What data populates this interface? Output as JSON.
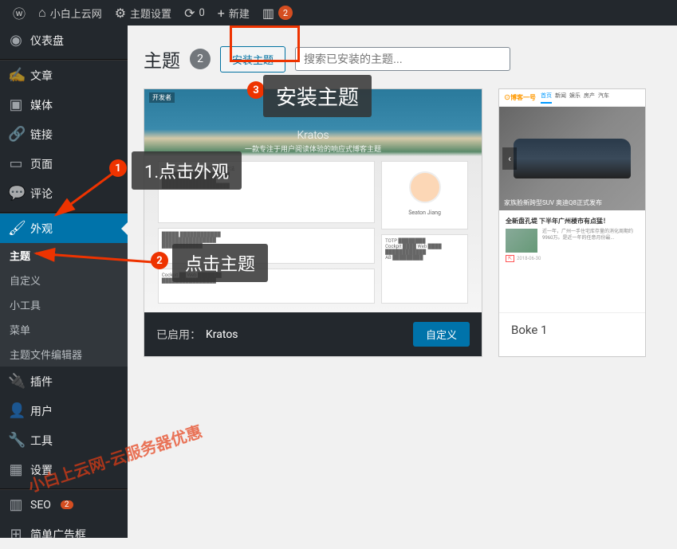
{
  "topbar": {
    "site_name": "小白上云网",
    "theme_settings": "主题设置",
    "updates_count": "0",
    "new_label": "新建",
    "comments_count": "2"
  },
  "sidebar": {
    "dashboard": "仪表盘",
    "posts": "文章",
    "media": "媒体",
    "links": "链接",
    "pages": "页面",
    "comments": "评论",
    "appearance": "外观",
    "plugins": "插件",
    "users": "用户",
    "tools": "工具",
    "settings": "设置",
    "seo": "SEO",
    "seo_badge": "2",
    "ads": "简单广告框",
    "sub": {
      "themes": "主题",
      "customize": "自定义",
      "widgets": "小工具",
      "menus": "菜单",
      "editor": "主题文件编辑器"
    }
  },
  "page": {
    "title": "主题",
    "count": "2",
    "install_btn": "安装主题",
    "search_placeholder": "搜索已安装的主题..."
  },
  "theme_active": {
    "enabled_label": "已启用：",
    "name": "Kratos",
    "customize_btn": "自定义",
    "shot_title": "Kratos",
    "shot_sub": "一款专注于用户阅读体验的响应式博客主题",
    "corner_label": "开发者"
  },
  "theme_other": {
    "name": "Boke 1",
    "logo": "⊙博客一号",
    "nav": [
      "首页",
      "新闻",
      "娱乐",
      "房产",
      "汽车"
    ],
    "hero_cap": "家族脸新跨型SUV 奥迪Q8正式发布",
    "article_title": "全新盘孔堤 下半年广州楼市有点猛！",
    "article_text": "近一年，广州一手住宅库存量的消化周期约9960万。是近一年的任意月份最...",
    "article_date": "2018-06-30"
  },
  "annotations": {
    "num1": "1",
    "num2": "2",
    "num3": "3",
    "label1": "1.点击外观",
    "label2": "点击主题",
    "label3": "安装主题"
  },
  "watermark": "小白上云网-云服务器优惠"
}
